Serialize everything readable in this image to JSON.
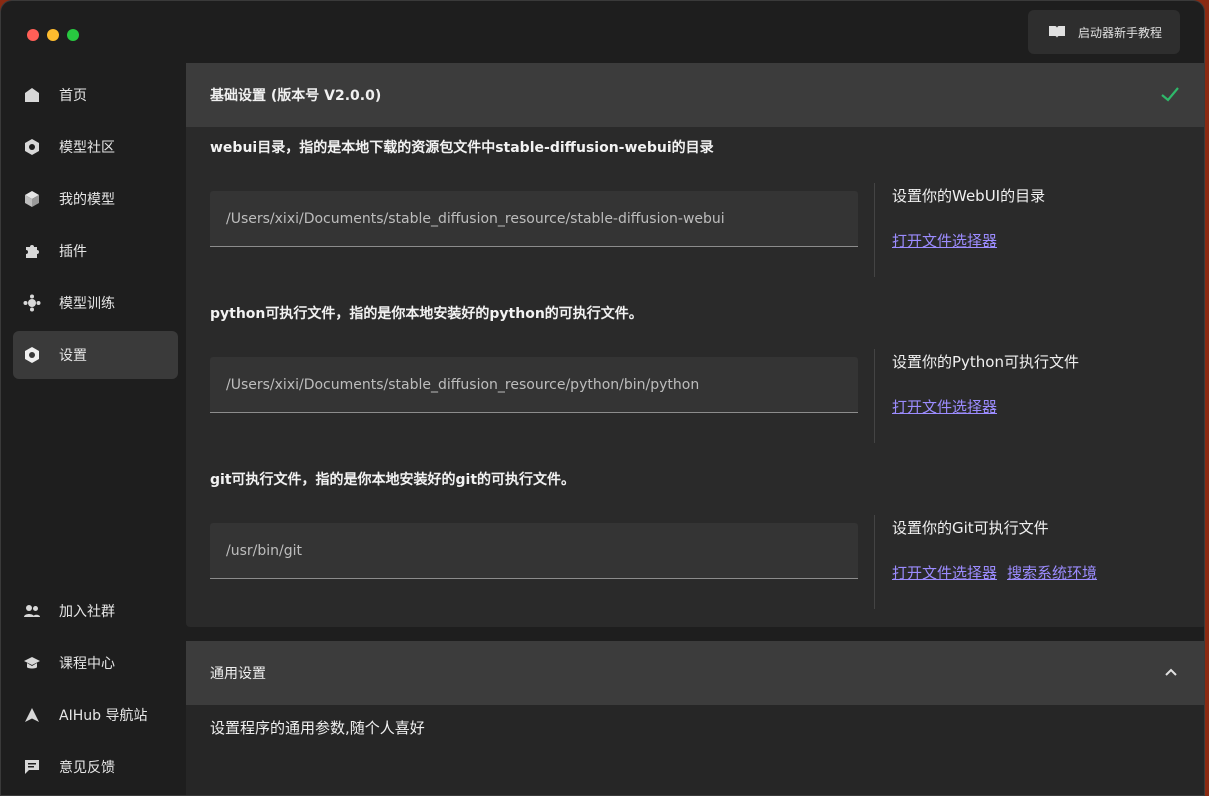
{
  "tutorial_button": {
    "label": "启动器新手教程",
    "icon": "book-icon"
  },
  "sidebar": {
    "items": [
      {
        "label": "首页",
        "icon": "home-icon"
      },
      {
        "label": "模型社区",
        "icon": "community-icon"
      },
      {
        "label": "我的模型",
        "icon": "cube-icon"
      },
      {
        "label": "插件",
        "icon": "puzzle-icon"
      },
      {
        "label": "模型训练",
        "icon": "training-icon"
      },
      {
        "label": "设置",
        "icon": "settings-icon",
        "active": true
      },
      {
        "label": "加入社群",
        "icon": "people-icon"
      },
      {
        "label": "课程中心",
        "icon": "graduation-cap-icon"
      },
      {
        "label": "AIHub 导航站",
        "icon": "navigation-arrow-icon"
      },
      {
        "label": "意见反馈",
        "icon": "feedback-icon"
      }
    ]
  },
  "basic_settings": {
    "title": "基础设置 (版本号 V2.0.0)",
    "sections": [
      {
        "description": "webui目录，指的是本地下载的资源包文件中stable-diffusion-webui的目录",
        "path": "/Users/xixi/Documents/stable_diffusion_resource/stable-diffusion-webui",
        "side_title": "设置你的WebUI的目录",
        "links": [
          "打开文件选择器"
        ]
      },
      {
        "description": "python可执行文件，指的是你本地安装好的python的可执行文件。",
        "path": "/Users/xixi/Documents/stable_diffusion_resource/python/bin/python",
        "side_title": "设置你的Python可执行文件",
        "links": [
          "打开文件选择器"
        ]
      },
      {
        "description": "git可执行文件，指的是你本地安装好的git的可执行文件。",
        "path": "/usr/bin/git",
        "side_title": "设置你的Git可执行文件",
        "links": [
          "打开文件选择器",
          "搜索系统环境"
        ]
      }
    ]
  },
  "general_settings": {
    "title": "通用设置",
    "description": "设置程序的通用参数,随个人喜好"
  },
  "colors": {
    "accent_link": "#9c8cff",
    "check": "#2fb86a"
  }
}
